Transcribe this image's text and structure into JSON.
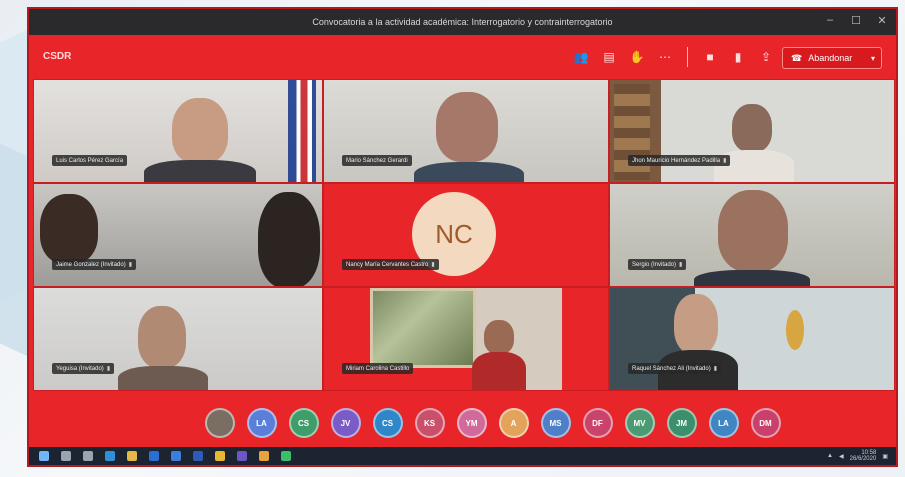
{
  "window": {
    "title": "Convocatoria a la actividad académica: Interrogatorio y contrainterrogatorio",
    "minimize": "–",
    "maximize": "☐",
    "close": "✕"
  },
  "toolbar": {
    "app_label": "CSDR",
    "leave_label": "Abandonar",
    "leave_caret": "▾",
    "icons": [
      "people-icon",
      "chat-icon",
      "hand-icon",
      "more-icon",
      "camera-icon",
      "mic-icon",
      "share-icon"
    ]
  },
  "tiles": [
    {
      "name": "Luis Carlos Pérez García",
      "mic": ""
    },
    {
      "name": "Mario Sánchez Gerardi",
      "mic": ""
    },
    {
      "name": "Jhon Mauricio Hernández Padilla",
      "mic": "🎤"
    },
    {
      "name": "Jaime Gonzalez (Invitado)",
      "mic": "🎤"
    },
    {
      "name": "Nancy María Cervantes Castro",
      "mic": "🎤",
      "initials": "NC"
    },
    {
      "name": "Sergio (Invitado)",
      "mic": "🎤"
    },
    {
      "name": "Yeguisa (Invitado)",
      "mic": "🎤"
    },
    {
      "name": "Miriam Carolina Castillo",
      "mic": ""
    },
    {
      "name": "Raquel Sánchez Ali (Invitado)",
      "mic": "🎤"
    }
  ],
  "avatars": [
    {
      "initials": "",
      "color": "#7a6e62"
    },
    {
      "initials": "LA",
      "color": "#5b7fd9"
    },
    {
      "initials": "CS",
      "color": "#3f9d6a"
    },
    {
      "initials": "JV",
      "color": "#7a5cc7"
    },
    {
      "initials": "CS",
      "color": "#2f86c9"
    },
    {
      "initials": "KS",
      "color": "#c94f6a"
    },
    {
      "initials": "YM",
      "color": "#d06a9a"
    },
    {
      "initials": "A",
      "color": "#e3a35a"
    },
    {
      "initials": "MS",
      "color": "#4f7fc9"
    },
    {
      "initials": "DF",
      "color": "#c9436a"
    },
    {
      "initials": "MV",
      "color": "#4b9a72"
    },
    {
      "initials": "JM",
      "color": "#3b8f6b"
    },
    {
      "initials": "LA",
      "color": "#3f86c2"
    },
    {
      "initials": "DM",
      "color": "#c9406a"
    }
  ],
  "taskbar": {
    "time": "10:58",
    "date": "26/6/2020"
  }
}
